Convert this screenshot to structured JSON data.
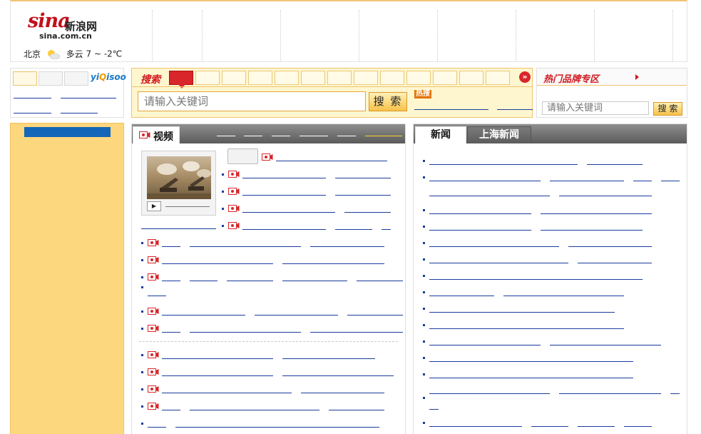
{
  "header": {
    "logo_text": "sina",
    "logo_cn": "新浪网",
    "logo_domain": "sina.com.cn",
    "weather": {
      "city": "北京",
      "condition": "多云",
      "temperature": "7 ~ -2℃",
      "icon": "partly-cloudy-icon"
    }
  },
  "search": {
    "title": "搜索",
    "input_placeholder": "请输入关键词",
    "button_label": "搜 索",
    "hot_badge": "热搜",
    "next_icon": "double-chevron-right-icon"
  },
  "brand_zone": {
    "title": "热门品牌专区",
    "input_placeholder": "请输入关键词",
    "button_label": "搜 索"
  },
  "yiqisoo": {
    "logo_prefix": "yi",
    "logo_mid": "Q",
    "logo_suffix": "isoo"
  },
  "video": {
    "tab_label": "视频"
  },
  "news": {
    "tabs": [
      "新闻",
      "上海新闻"
    ]
  },
  "colors": {
    "brand_red": "#c2101c",
    "link_blue": "#1a3d9e",
    "panel_yellow": "#fcd77e",
    "search_bg": "#fef6cf"
  }
}
